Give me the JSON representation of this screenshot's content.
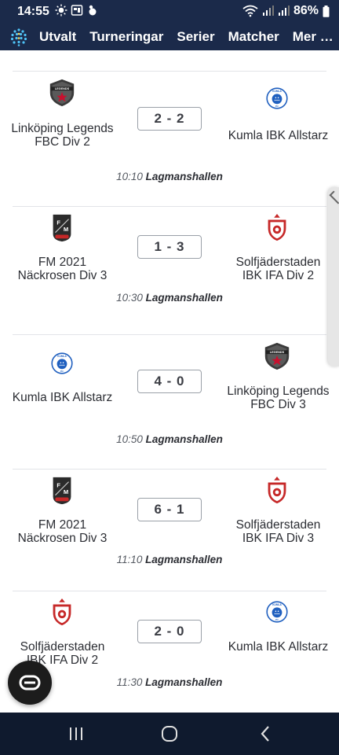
{
  "status_bar": {
    "time": "14:55",
    "battery_percent": "86%"
  },
  "nav": {
    "items": [
      "Utvalt",
      "Turneringar",
      "Serier",
      "Matcher",
      "Mer …"
    ]
  },
  "matches": [
    {
      "home": "Linköping Legends FBC Div 2",
      "home_logo": "legends-logo",
      "score": "2 - 2",
      "away": "Kumla IBK Allstarz",
      "away_logo": "kumla-logo",
      "time": "10:10",
      "venue": "Lagmanshallen"
    },
    {
      "home": "FM 2021 Näckrosen Div 3",
      "home_logo": "fm-logo",
      "score": "1 - 3",
      "away": "Solfjäderstaden IBK IFA Div 2",
      "away_logo": "solfjaderstaden-logo",
      "time": "10:30",
      "venue": "Lagmanshallen"
    },
    {
      "home": "Kumla IBK Allstarz",
      "home_logo": "kumla-logo",
      "score": "4 - 0",
      "away": "Linköping Legends FBC Div 3",
      "away_logo": "legends-logo",
      "time": "10:50",
      "venue": "Lagmanshallen"
    },
    {
      "home": "FM 2021 Näckrosen Div 3",
      "home_logo": "fm-logo",
      "score": "6 - 1",
      "away": "Solfjäderstaden IBK IFA Div 3",
      "away_logo": "solfjaderstaden-logo",
      "time": "11:10",
      "venue": "Lagmanshallen"
    },
    {
      "home": "Solfjäderstaden IBK IFA Div 2",
      "home_logo": "solfjaderstaden-logo",
      "score": "2 - 0",
      "away": "Kumla IBK Allstarz",
      "away_logo": "kumla-logo",
      "time": "11:30",
      "venue": "Lagmanshallen"
    }
  ],
  "colors": {
    "header_bg": "#1b2a4a",
    "legends_red": "#c8102e",
    "kumla_blue": "#1f5fbf",
    "solfjaderstaden_red": "#c62828"
  }
}
